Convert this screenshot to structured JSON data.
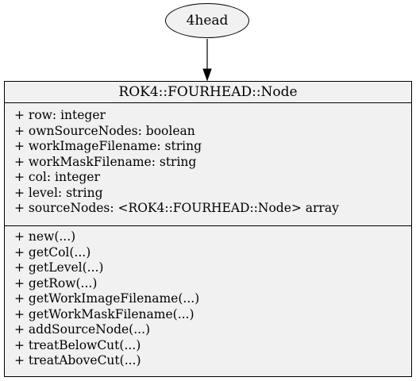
{
  "diagram": {
    "parent_node": {
      "label": "4head"
    },
    "class_node": {
      "title": "ROK4::FOURHEAD::Node",
      "attributes": [
        "+ row: integer",
        "+ ownSourceNodes: boolean",
        "+ workImageFilename: string",
        "+ workMaskFilename: string",
        "+ col: integer",
        "+ level: string",
        "+ sourceNodes: <ROK4::FOURHEAD::Node> array"
      ],
      "operations": [
        "+ new(...)",
        "+ getCol(...)",
        "+ getLevel(...)",
        "+ getRow(...)",
        "+ getWorkImageFilename(...)",
        "+ getWorkMaskFilename(...)",
        "+ addSourceNode(...)",
        "+ treatBelowCut(...)",
        "+ treatAboveCut(...)"
      ]
    },
    "edge": {
      "from": "4head",
      "to": "ROK4::FOURHEAD::Node"
    },
    "colors": {
      "node_fill": "#f1f1f1",
      "stroke": "#000000",
      "background": "#ffffff"
    }
  }
}
